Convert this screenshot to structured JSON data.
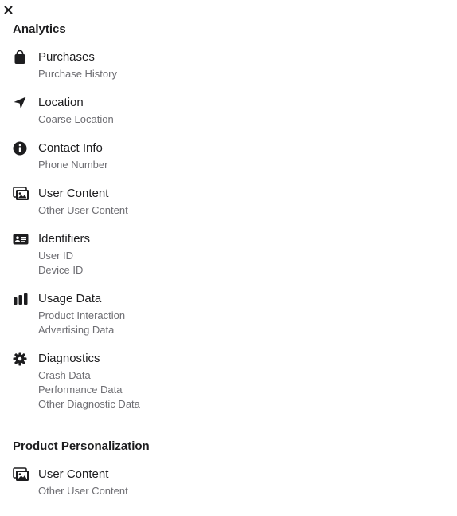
{
  "sections": [
    {
      "title": "Analytics",
      "categories": [
        {
          "name": "Purchases",
          "icon": "shopping-bag-icon",
          "items": [
            "Purchase History"
          ]
        },
        {
          "name": "Location",
          "icon": "location-arrow-icon",
          "items": [
            "Coarse Location"
          ]
        },
        {
          "name": "Contact Info",
          "icon": "info-circle-icon",
          "items": [
            "Phone Number"
          ]
        },
        {
          "name": "User Content",
          "icon": "photos-icon",
          "items": [
            "Other User Content"
          ]
        },
        {
          "name": "Identifiers",
          "icon": "id-card-icon",
          "items": [
            "User ID",
            "Device ID"
          ]
        },
        {
          "name": "Usage Data",
          "icon": "bar-chart-icon",
          "items": [
            "Product Interaction",
            "Advertising Data"
          ]
        },
        {
          "name": "Diagnostics",
          "icon": "gear-icon",
          "items": [
            "Crash Data",
            "Performance Data",
            "Other Diagnostic Data"
          ]
        }
      ]
    },
    {
      "title": "Product Personalization",
      "categories": [
        {
          "name": "User Content",
          "icon": "photos-icon",
          "items": [
            "Other User Content"
          ]
        }
      ]
    }
  ],
  "colors": {
    "text": "#1d1d1f",
    "secondary": "#6e6e73",
    "divider": "#d2d2d7"
  }
}
